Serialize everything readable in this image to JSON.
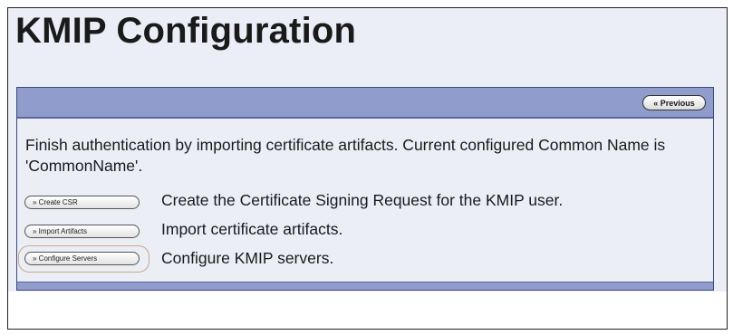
{
  "page": {
    "title": "KMIP Configuration"
  },
  "panel": {
    "previous_label": "« Previous",
    "description": "Finish authentication by importing certificate artifacts. Current configured Common Name is 'CommonName'.",
    "actions": [
      {
        "button_label": "» Create CSR",
        "text": "Create the Certificate Signing Request for the KMIP user."
      },
      {
        "button_label": "» Import Artifacts",
        "text": "Import certificate artifacts."
      },
      {
        "button_label": "» Configure Servers",
        "text": "Configure KMIP servers.",
        "highlighted": true
      }
    ]
  },
  "colors": {
    "panel_header": "#8f9ccc",
    "highlight_outline": "#c9a98a"
  }
}
